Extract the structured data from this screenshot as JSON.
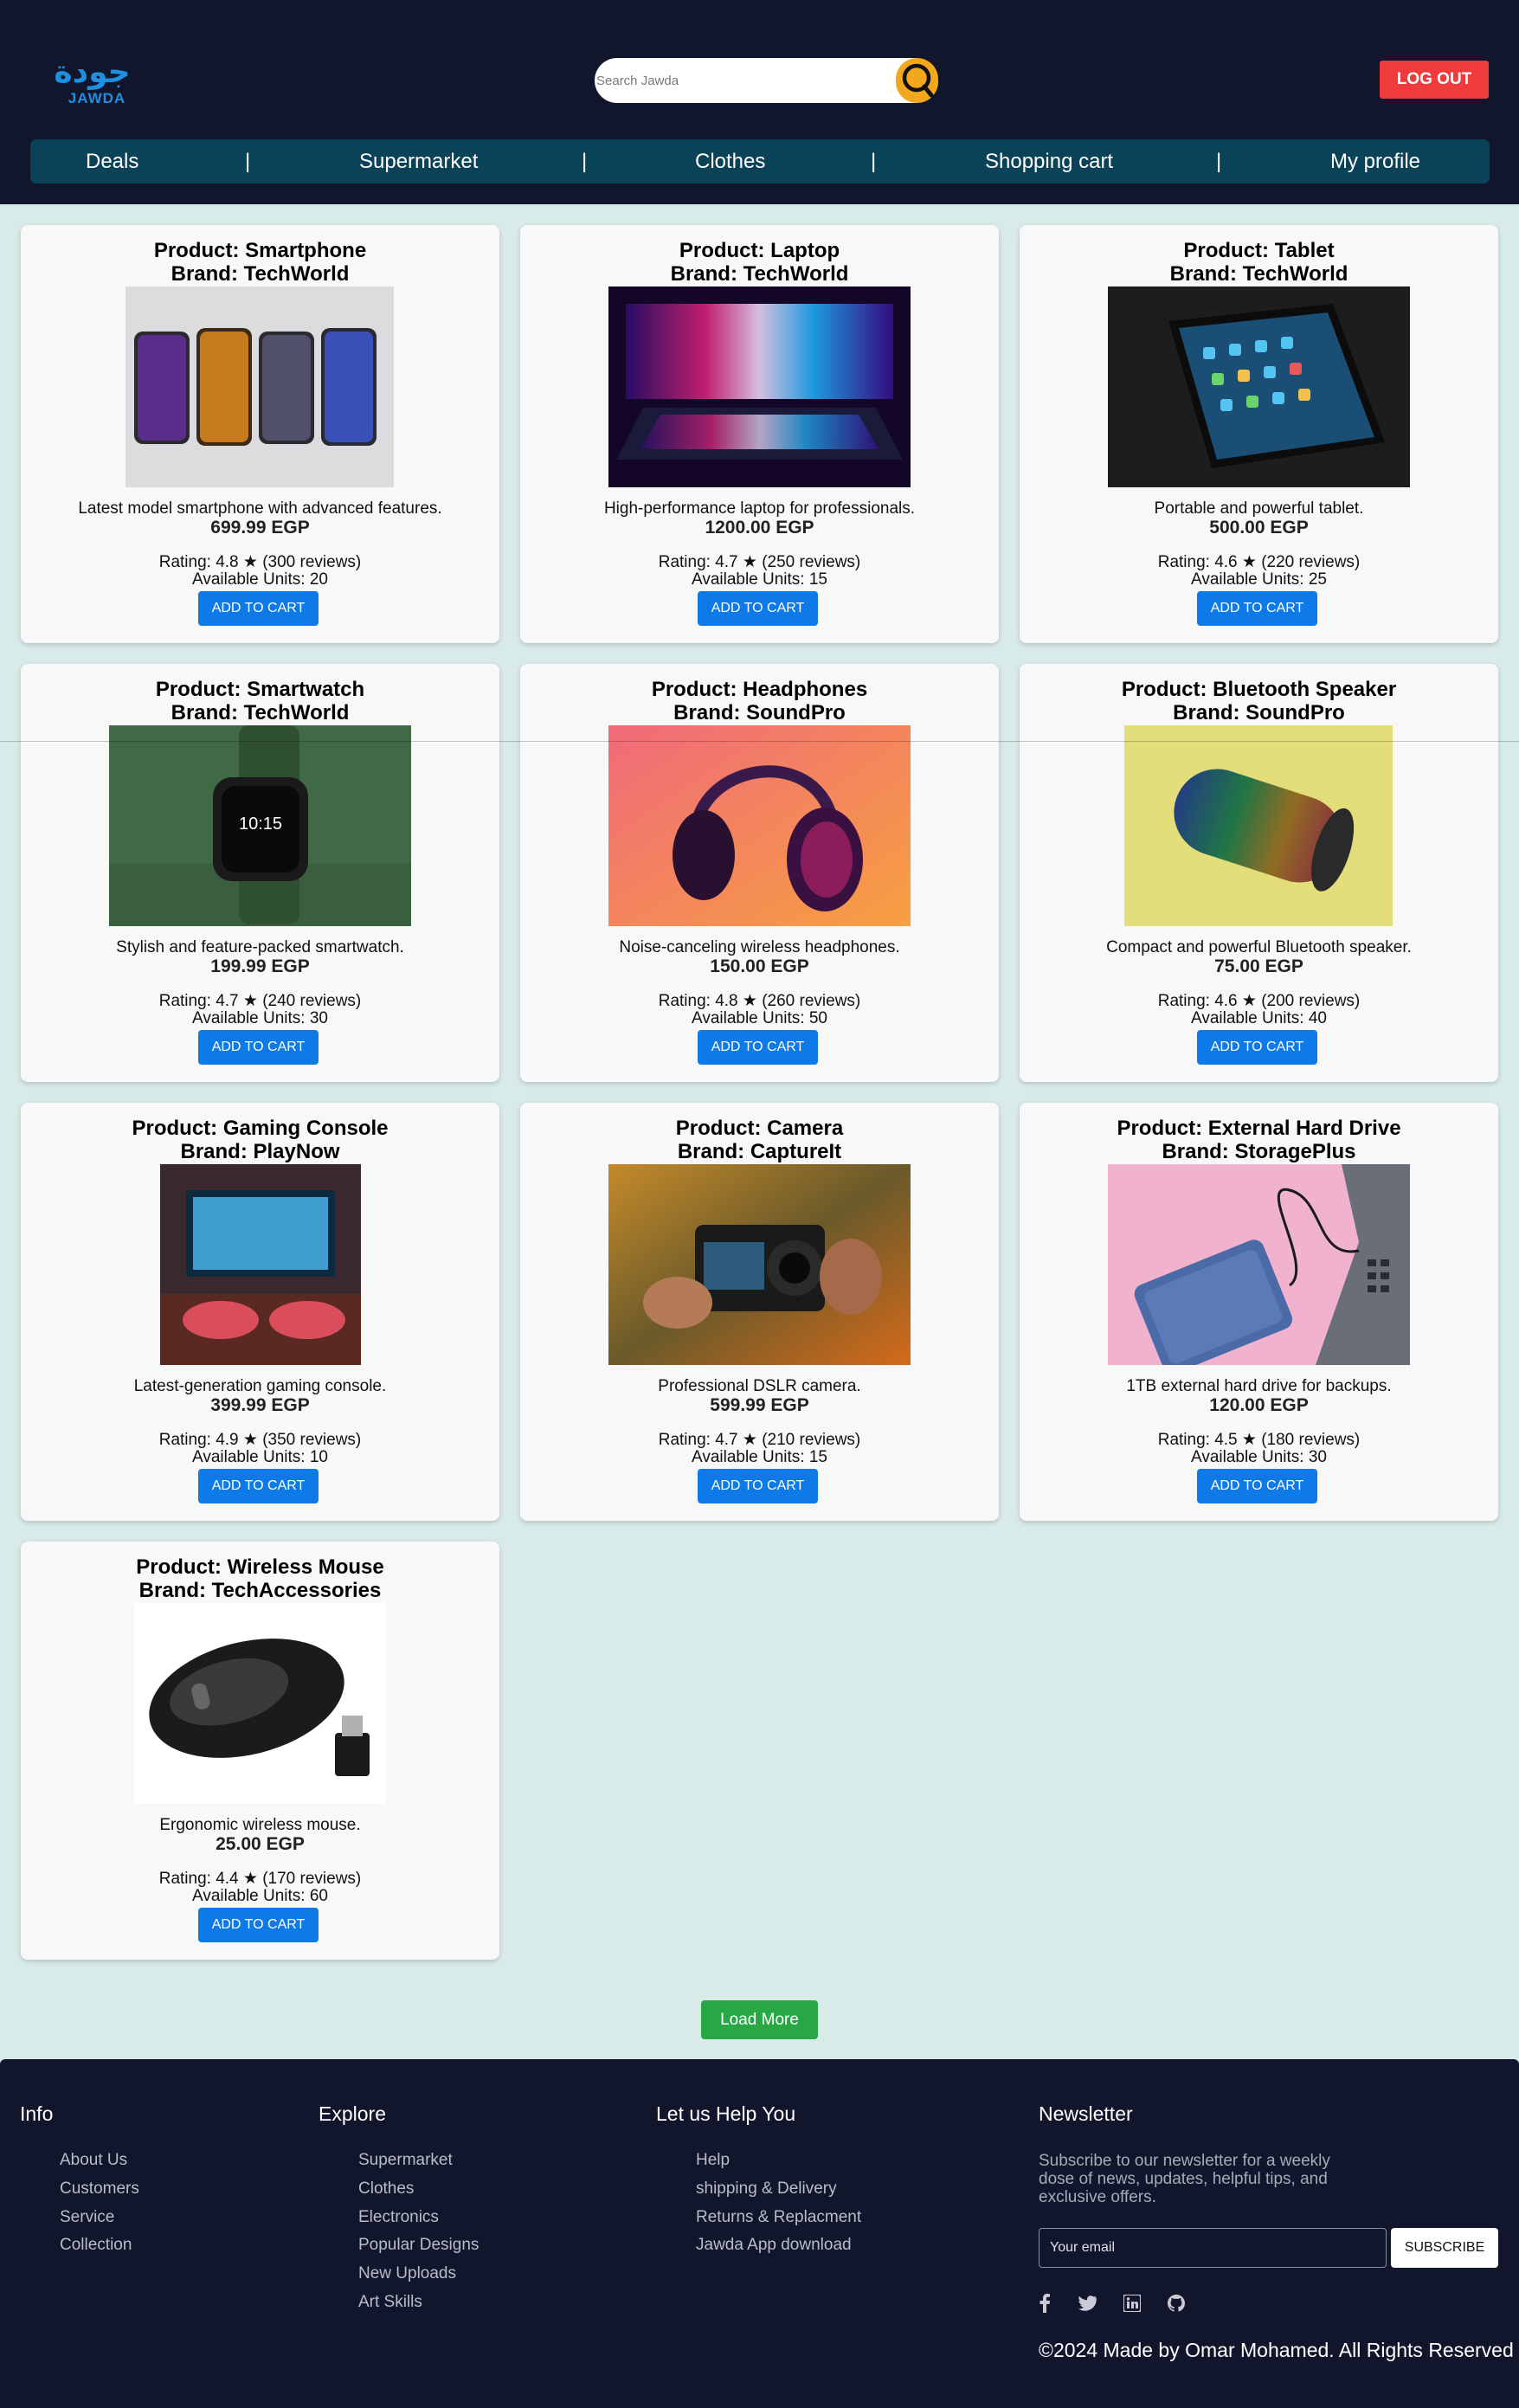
{
  "header": {
    "logo_arabic": "جودة",
    "logo_text": "JAWDA",
    "search_placeholder": "Search Jawda",
    "logout_label": "LOG OUT"
  },
  "nav": {
    "items": [
      "Deals",
      "Supermarket",
      "Clothes",
      "Shopping cart",
      "My profile"
    ],
    "separator": "|"
  },
  "products": [
    {
      "title": "Product: Smartphone",
      "brand": "Brand: TechWorld",
      "description": "Latest model smartphone with advanced features.",
      "price": "699.99 EGP",
      "rating": "Rating: 4.8 ★ (300 reviews)",
      "units": "Available Units: 20",
      "button": "ADD TO CART",
      "image": "smartphones-image"
    },
    {
      "title": "Product: Laptop",
      "brand": "Brand: TechWorld",
      "description": "High-performance laptop for professionals.",
      "price": "1200.00 EGP",
      "rating": "Rating: 4.7 ★ (250 reviews)",
      "units": "Available Units: 15",
      "button": "ADD TO CART",
      "image": "laptop-image"
    },
    {
      "title": "Product: Tablet",
      "brand": "Brand: TechWorld",
      "description": "Portable and powerful tablet.",
      "price": "500.00 EGP",
      "rating": "Rating: 4.6 ★ (220 reviews)",
      "units": "Available Units: 25",
      "button": "ADD TO CART",
      "image": "tablet-image"
    },
    {
      "title": "Product: Smartwatch",
      "brand": "Brand: TechWorld",
      "description": "Stylish and feature-packed smartwatch.",
      "price": "199.99 EGP",
      "rating": "Rating: 4.7 ★ (240 reviews)",
      "units": "Available Units: 30",
      "button": "ADD TO CART",
      "image": "smartwatch-image",
      "watch_time": "10:15"
    },
    {
      "title": "Product: Headphones",
      "brand": "Brand: SoundPro",
      "description": "Noise-canceling wireless headphones.",
      "price": "150.00 EGP",
      "rating": "Rating: 4.8 ★ (260 reviews)",
      "units": "Available Units: 50",
      "button": "ADD TO CART",
      "image": "headphones-image"
    },
    {
      "title": "Product: Bluetooth Speaker",
      "brand": "Brand: SoundPro",
      "description": "Compact and powerful Bluetooth speaker.",
      "price": "75.00 EGP",
      "rating": "Rating: 4.6 ★ (200 reviews)",
      "units": "Available Units: 40",
      "button": "ADD TO CART",
      "image": "speaker-image"
    },
    {
      "title": "Product: Gaming Console",
      "brand": "Brand: PlayNow",
      "description": "Latest-generation gaming console.",
      "price": "399.99 EGP",
      "rating": "Rating: 4.9 ★ (350 reviews)",
      "units": "Available Units: 10",
      "button": "ADD TO CART",
      "image": "gaming-console-image"
    },
    {
      "title": "Product: Camera",
      "brand": "Brand: CaptureIt",
      "description": "Professional DSLR camera.",
      "price": "599.99 EGP",
      "rating": "Rating: 4.7 ★ (210 reviews)",
      "units": "Available Units: 15",
      "button": "ADD TO CART",
      "image": "camera-image"
    },
    {
      "title": "Product: External Hard Drive",
      "brand": "Brand: StoragePlus",
      "description": "1TB external hard drive for backups.",
      "price": "120.00 EGP",
      "rating": "Rating: 4.5 ★ (180 reviews)",
      "units": "Available Units: 30",
      "button": "ADD TO CART",
      "image": "hard-drive-image"
    },
    {
      "title": "Product: Wireless Mouse",
      "brand": "Brand: TechAccessories",
      "description": "Ergonomic wireless mouse.",
      "price": "25.00 EGP",
      "rating": "Rating: 4.4 ★ (170 reviews)",
      "units": "Available Units: 60",
      "button": "ADD TO CART",
      "image": "mouse-image"
    }
  ],
  "load_more_label": "Load More",
  "footer": {
    "info": {
      "heading": "Info",
      "links": [
        "About Us",
        "Customers",
        "Service",
        "Collection"
      ]
    },
    "explore": {
      "heading": "Explore",
      "links": [
        "Supermarket",
        "Clothes",
        "Electronics",
        "Popular Designs",
        "New Uploads",
        "Art Skills"
      ]
    },
    "help": {
      "heading": "Let us Help You",
      "links": [
        "Help",
        "shipping & Delivery",
        "Returns & Replacment",
        "Jawda App download"
      ]
    },
    "newsletter": {
      "heading": "Newsletter",
      "text": "Subscribe to our newsletter for a weekly dose of news, updates, helpful tips, and exclusive offers.",
      "email_placeholder": "Your email",
      "subscribe_label": "SUBSCRIBE"
    },
    "social_icons": [
      "facebook-icon",
      "twitter-icon",
      "linkedin-icon",
      "github-icon"
    ],
    "copyright": "©2024 Made by Omar Mohamed. All Rights Reserved"
  },
  "colors": {
    "header_bg": "#11162d",
    "nav_bg": "#0a4257",
    "page_bg": "#d9ebe9",
    "logout": "#ef3b3b",
    "accent_blue": "#0d7ae8",
    "load_more": "#28a745",
    "search_button": "#f2a81d"
  }
}
